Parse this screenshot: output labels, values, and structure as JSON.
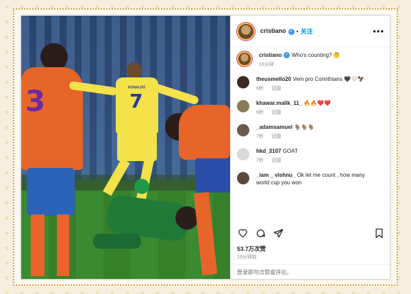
{
  "post": {
    "username": "cristiano",
    "follow_label": "关注",
    "caption": "Who's counting? 🤔",
    "caption_time": "16分钟",
    "likes": "53.7万次赞",
    "time": "16分钟前",
    "login_prompt": "登录即可点赞或评论。",
    "player_number": "7",
    "player_name_on_shirt": "RONALDO",
    "opponent_number": "3"
  },
  "comments": [
    {
      "user": "theusmello20",
      "text": "Vem pro Corinthians 🖤🤍🦅",
      "time": "6秒",
      "reply": "回复",
      "avatar_color": "#3a2a22"
    },
    {
      "user": "khawar.malik_11_",
      "text": "🔥🔥❤️❤️",
      "time": "6秒",
      "reply": "回复",
      "avatar_color": "#8a7a55"
    },
    {
      "user": "_adamsamuel",
      "text": "🐐🐐🐐",
      "time": "7秒",
      "reply": "回复",
      "avatar_color": "#6b5a4a"
    },
    {
      "user": "hkd_3107",
      "text": "GOAT",
      "time": "7秒",
      "reply": "回复",
      "avatar_color": "#d9d9d9"
    },
    {
      "user": "_iam__vishnu_",
      "text": "Ok let me count , how many world cup you won",
      "time": "",
      "reply": "",
      "avatar_color": "#5a4a3a"
    }
  ],
  "icons": {
    "like": "heart-icon",
    "comment": "comment-icon",
    "share": "send-icon",
    "save": "bookmark-icon",
    "more": "more-icon"
  },
  "colors": {
    "accent": "#0095f6",
    "border": "#d1a23f"
  }
}
